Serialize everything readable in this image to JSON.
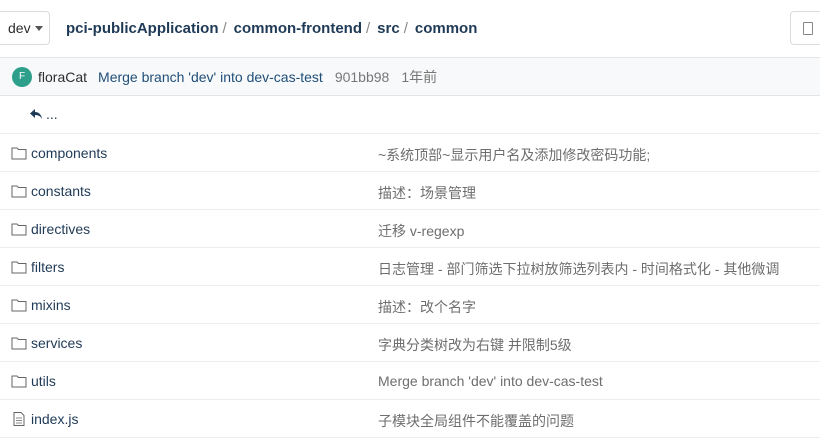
{
  "header": {
    "branch": "dev",
    "breadcrumb": [
      "pci-publicApplication",
      "common-frontend",
      "src",
      "common"
    ]
  },
  "commit": {
    "avatar_letter": "F",
    "avatar_color": "#2d9f8b",
    "author": "floraCat",
    "message": "Merge branch 'dev' into dev-cas-test",
    "sha": "901bb98",
    "time": "1年前"
  },
  "up_label": "...",
  "files": [
    {
      "name": "components",
      "type": "folder",
      "message": "~系统顶部~显示用户名及添加修改密码功能;"
    },
    {
      "name": "constants",
      "type": "folder",
      "message": "描述：场景管理"
    },
    {
      "name": "directives",
      "type": "folder",
      "message": "迁移 v-regexp"
    },
    {
      "name": "filters",
      "type": "folder",
      "message": "日志管理 - 部门筛选下拉树放筛选列表内 - 时间格式化 - 其他微调"
    },
    {
      "name": "mixins",
      "type": "folder",
      "message": "描述：改个名字"
    },
    {
      "name": "services",
      "type": "folder",
      "message": "字典分类树改为右键 并限制5级"
    },
    {
      "name": "utils",
      "type": "folder",
      "message": "Merge branch 'dev' into dev-cas-test"
    },
    {
      "name": "index.js",
      "type": "file",
      "message": "子模块全局组件不能覆盖的问题"
    }
  ]
}
